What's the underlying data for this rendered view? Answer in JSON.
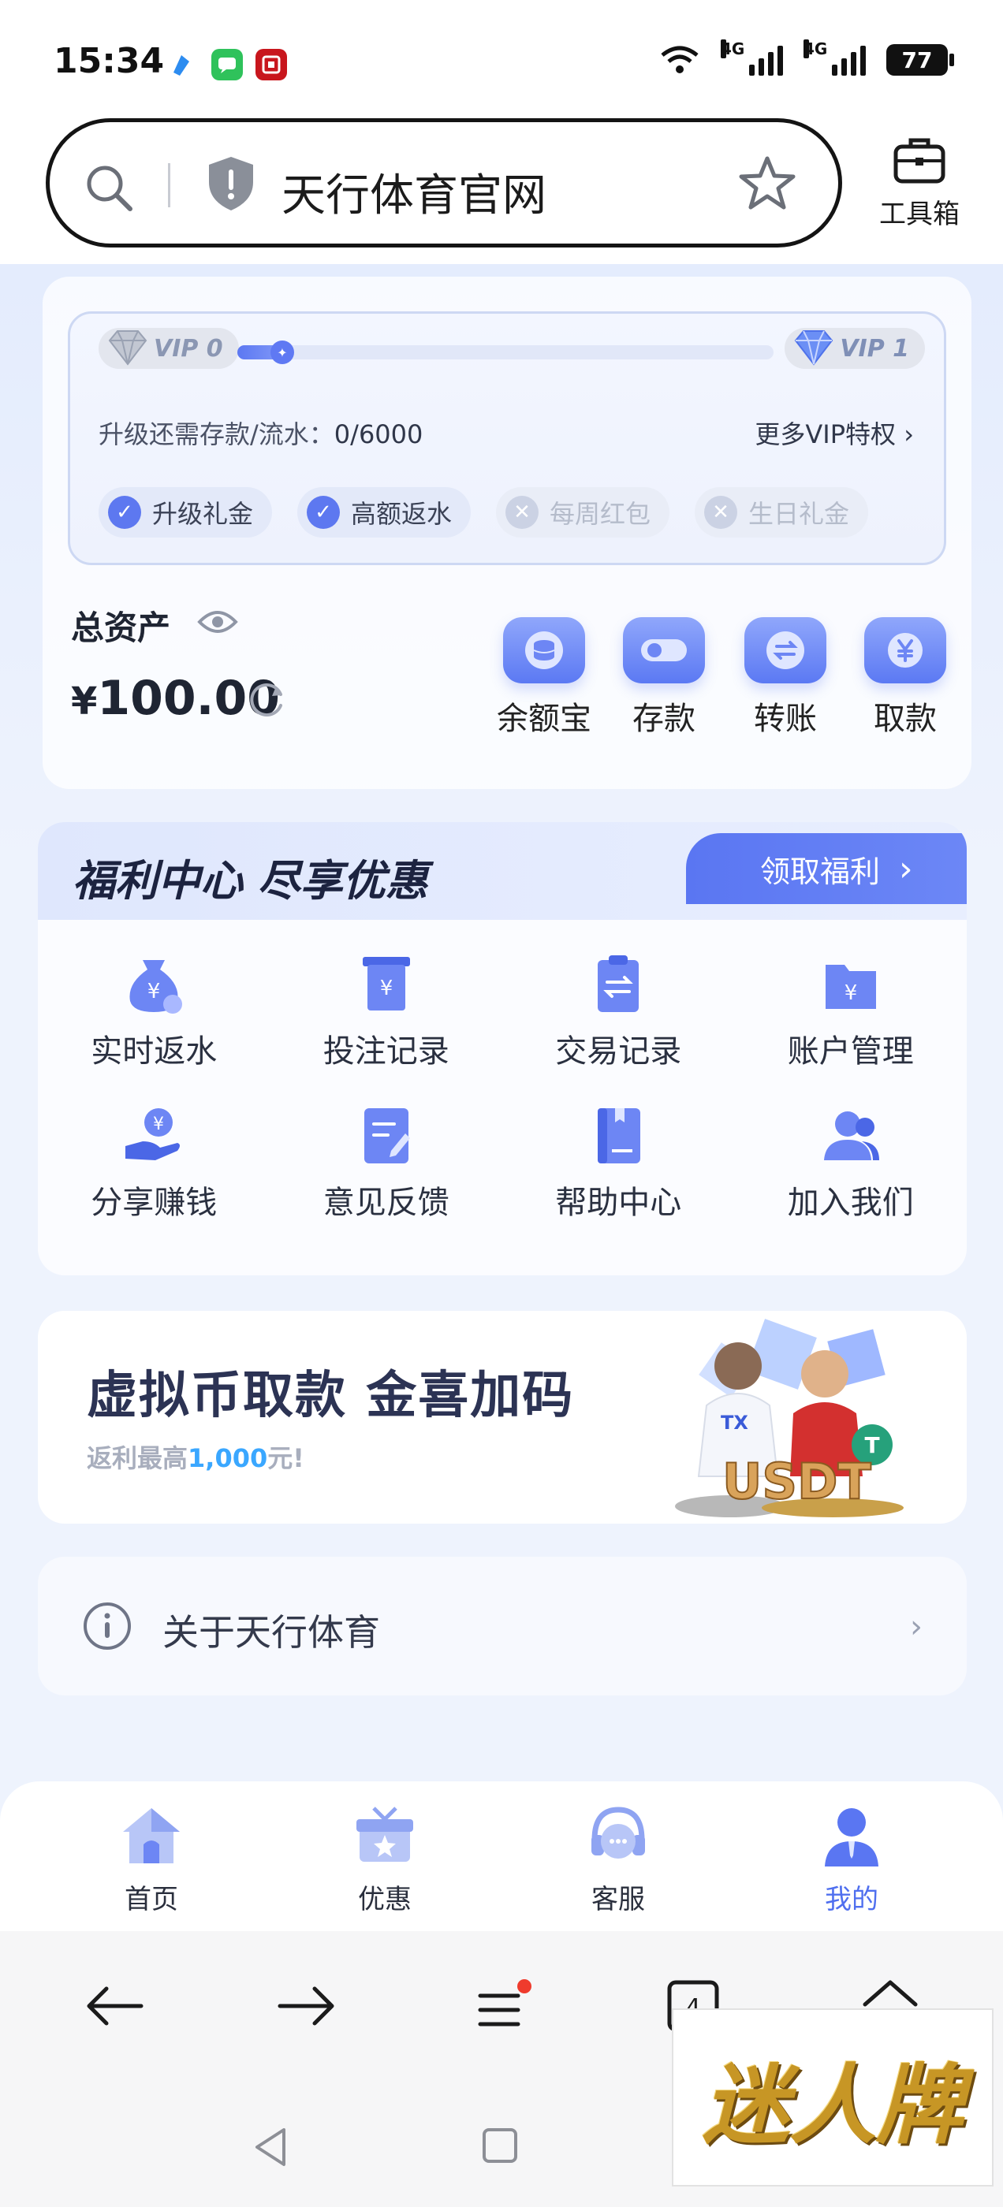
{
  "status_bar": {
    "time": "15:34",
    "network_1": "4G",
    "network_2": "4G",
    "battery": "77",
    "icons": [
      "app-icon-blue",
      "message-app-icon",
      "bank-app-icon",
      "wifi-icon",
      "signal-icon",
      "battery-icon"
    ]
  },
  "browser": {
    "address_text": "天行体育官网",
    "toolbox_label": "工具箱"
  },
  "vip": {
    "current_level": "VIP 0",
    "next_level": "VIP 1",
    "progress_label": "升级还需存款/流水：",
    "progress_value": "0/6000",
    "progress_fraction": 0,
    "more_link": "更多VIP特权",
    "perks": [
      {
        "label": "升级礼金",
        "enabled": true
      },
      {
        "label": "高额返水",
        "enabled": true
      },
      {
        "label": "每周红包",
        "enabled": false
      },
      {
        "label": "生日礼金",
        "enabled": false
      }
    ]
  },
  "assets": {
    "label": "总资产",
    "currency": "¥",
    "amount": "100.00",
    "actions": [
      {
        "label": "余额宝",
        "icon": "coin-stack-icon"
      },
      {
        "label": "存款",
        "icon": "card-icon"
      },
      {
        "label": "转账",
        "icon": "transfer-icon"
      },
      {
        "label": "取款",
        "icon": "yuan-withdraw-icon"
      }
    ]
  },
  "welfare": {
    "title": "福利中心 尽享优惠",
    "button_label": "领取福利",
    "items": [
      {
        "label": "实时返水",
        "icon": "money-bag-icon"
      },
      {
        "label": "投注记录",
        "icon": "receipt-icon"
      },
      {
        "label": "交易记录",
        "icon": "clipboard-transfer-icon"
      },
      {
        "label": "账户管理",
        "icon": "folder-yuan-icon"
      },
      {
        "label": "分享赚钱",
        "icon": "hand-coin-icon"
      },
      {
        "label": "意见反馈",
        "icon": "edit-note-icon"
      },
      {
        "label": "帮助中心",
        "icon": "book-icon"
      },
      {
        "label": "加入我们",
        "icon": "people-icon"
      }
    ]
  },
  "banner": {
    "title": "虚拟币取款 金喜加码",
    "subtitle_prefix": "返利最高",
    "subtitle_amount": "1,000",
    "subtitle_suffix": "元!",
    "art_label": "USDT",
    "jersey_label": "TX"
  },
  "about": {
    "label": "关于天行体育"
  },
  "tabs": [
    {
      "label": "首页",
      "icon": "home-icon",
      "active": false
    },
    {
      "label": "优惠",
      "icon": "gift-icon",
      "active": false
    },
    {
      "label": "客服",
      "icon": "headset-icon",
      "active": false
    },
    {
      "label": "我的",
      "icon": "user-icon",
      "active": true
    }
  ],
  "browser_nav": {
    "tabs_count": "4",
    "icons": [
      "back-arrow-icon",
      "forward-arrow-icon",
      "menu-icon",
      "tabs-icon",
      "home-icon"
    ]
  },
  "watermark": {
    "text": "迷人牌"
  },
  "colors": {
    "accent": "#5a76f2",
    "highlight": "#3aa7ff",
    "background": "#eef3fd"
  }
}
